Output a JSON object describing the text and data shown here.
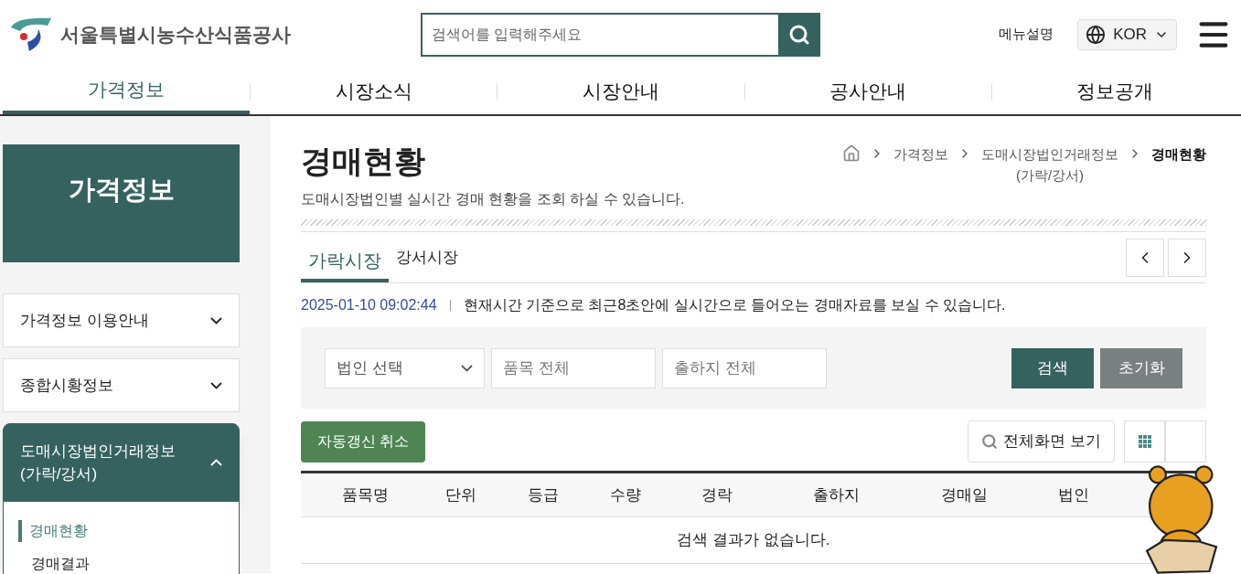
{
  "header": {
    "logo_text": "서울특별시농수산식품공사",
    "search": {
      "placeholder": "검색어를 입력해주세요"
    },
    "menu_help": "메뉴설명",
    "language": "KOR"
  },
  "nav": [
    {
      "label": "가격정보",
      "selected": true
    },
    {
      "label": "시장소식",
      "selected": false
    },
    {
      "label": "시장안내",
      "selected": false
    },
    {
      "label": "공사안내",
      "selected": false
    },
    {
      "label": "정보공개",
      "selected": false
    }
  ],
  "sidebar": {
    "title": "가격정보",
    "items": [
      {
        "label": "가격정보 이용안내",
        "expanded": false
      },
      {
        "label": "종합시황정보",
        "expanded": false
      },
      {
        "label": "도매시장법인거래정보\n(가락/강서)",
        "expanded": true,
        "children": [
          {
            "label": "경매현황",
            "selected": true
          },
          {
            "label": "경매결과",
            "selected": false
          }
        ]
      }
    ]
  },
  "page": {
    "title": "경매현황",
    "description": "도매시장법인별 실시간 경매 현황을 조회 하실 수 있습니다.",
    "breadcrumb": [
      "가격정보",
      "도매시장법인거래정보\n(가락/강서)",
      "경매현황"
    ]
  },
  "tabs": [
    {
      "label": "가락시장",
      "selected": true
    },
    {
      "label": "강서시장",
      "selected": false
    }
  ],
  "timestamp": "2025-01-10 09:02:44",
  "notice": "현재시간 기준으로 최근8초안에 실시간으로 들어오는 경매자료를 보실 수 있습니다.",
  "filters": {
    "corporation": "법인 선택",
    "item": {
      "placeholder": "품목 전체"
    },
    "origin": {
      "placeholder": "출하지 전체"
    },
    "search_button": "검색",
    "reset_button": "초기화"
  },
  "toolbar": {
    "auto_refresh_button": "자동갱신 취소",
    "fullscreen_button": "전체화면 보기"
  },
  "table": {
    "columns": [
      "품목명",
      "단위",
      "등급",
      "수량",
      "경락",
      "출하지",
      "경매일",
      "법인"
    ],
    "empty_message": "검색 결과가 없습니다."
  }
}
